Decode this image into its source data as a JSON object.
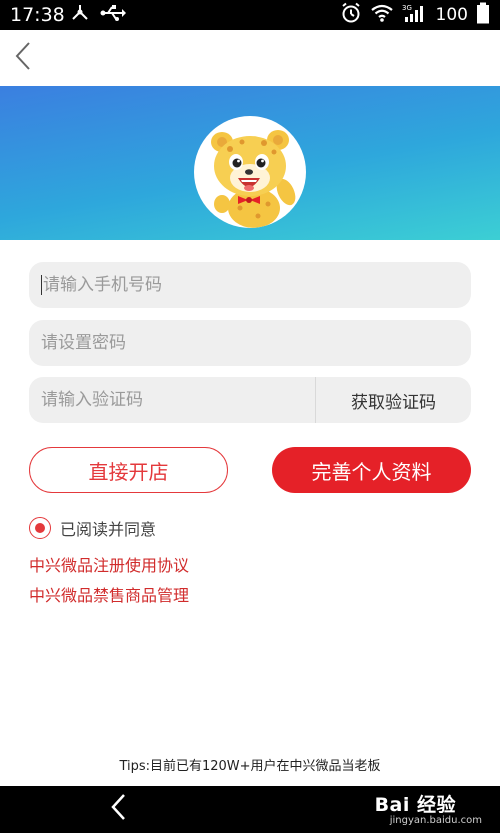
{
  "status_bar": {
    "time": "17:38",
    "battery": "100",
    "icons": [
      "usb-debug-icon",
      "usb-icon",
      "alarm-icon",
      "wifi-icon",
      "signal-3g-icon"
    ]
  },
  "nav": {
    "back_icon": "chevron-left-icon"
  },
  "form": {
    "phone_placeholder": "请输入手机号码",
    "password_placeholder": "请设置密码",
    "code_placeholder": "请输入验证码",
    "get_code_label": "获取验证码"
  },
  "buttons": {
    "open_store": "直接开店",
    "complete_profile": "完善个人资料"
  },
  "agreement": {
    "checked": true,
    "label": "已阅读并同意",
    "links": [
      "中兴微品注册使用协议",
      "中兴微品禁售商品管理"
    ]
  },
  "tips": "Tips:目前已有120W+用户在中兴微品当老板",
  "watermark": {
    "brand": "Bai 经验",
    "url": "jingyan.baidu.com"
  },
  "colors": {
    "accent": "#e52128",
    "banner_start": "#3b7fe0",
    "banner_end": "#3ccfd4",
    "field_bg": "#efefef"
  }
}
